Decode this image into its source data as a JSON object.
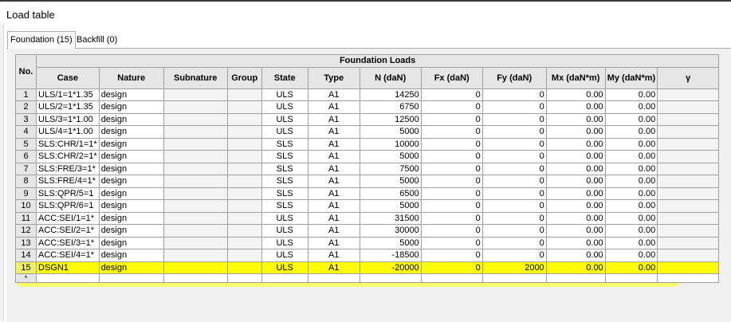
{
  "window": {
    "title": "Load table"
  },
  "tabs": [
    {
      "label": "Foundation (15)",
      "active": true
    },
    {
      "label": "Backfill (0)",
      "active": false
    }
  ],
  "table": {
    "group_header": "Foundation Loads",
    "no_header": "No.",
    "columns": [
      "Case",
      "Nature",
      "Subnature",
      "Group",
      "State",
      "Type",
      "N (daN)",
      "Fx (daN)",
      "Fy (daN)",
      "Mx (daN*m)",
      "My (daN*m)",
      "γ"
    ],
    "rows": [
      {
        "no": "1",
        "case": "ULS/1=1*1.35",
        "nature": "design",
        "subnature": "",
        "group": "",
        "state": "ULS",
        "type": "A1",
        "n": "14250",
        "fx": "0",
        "fy": "0",
        "mx": "0.00",
        "my": "0.00",
        "gamma": ""
      },
      {
        "no": "2",
        "case": "ULS/2=1*1.35",
        "nature": "design",
        "subnature": "",
        "group": "",
        "state": "ULS",
        "type": "A1",
        "n": "6750",
        "fx": "0",
        "fy": "0",
        "mx": "0.00",
        "my": "0.00",
        "gamma": ""
      },
      {
        "no": "3",
        "case": "ULS/3=1*1.00",
        "nature": "design",
        "subnature": "",
        "group": "",
        "state": "ULS",
        "type": "A1",
        "n": "12500",
        "fx": "0",
        "fy": "0",
        "mx": "0.00",
        "my": "0.00",
        "gamma": ""
      },
      {
        "no": "4",
        "case": "ULS/4=1*1.00",
        "nature": "design",
        "subnature": "",
        "group": "",
        "state": "ULS",
        "type": "A1",
        "n": "5000",
        "fx": "0",
        "fy": "0",
        "mx": "0.00",
        "my": "0.00",
        "gamma": ""
      },
      {
        "no": "5",
        "case": "SLS:CHR/1=1*",
        "nature": "design",
        "subnature": "",
        "group": "",
        "state": "SLS",
        "type": "A1",
        "n": "10000",
        "fx": "0",
        "fy": "0",
        "mx": "0.00",
        "my": "0.00",
        "gamma": ""
      },
      {
        "no": "6",
        "case": "SLS:CHR/2=1*",
        "nature": "design",
        "subnature": "",
        "group": "",
        "state": "SLS",
        "type": "A1",
        "n": "5000",
        "fx": "0",
        "fy": "0",
        "mx": "0.00",
        "my": "0.00",
        "gamma": ""
      },
      {
        "no": "7",
        "case": "SLS:FRE/3=1*",
        "nature": "design",
        "subnature": "",
        "group": "",
        "state": "SLS",
        "type": "A1",
        "n": "7500",
        "fx": "0",
        "fy": "0",
        "mx": "0.00",
        "my": "0.00",
        "gamma": ""
      },
      {
        "no": "8",
        "case": "SLS:FRE/4=1*",
        "nature": "design",
        "subnature": "",
        "group": "",
        "state": "SLS",
        "type": "A1",
        "n": "5000",
        "fx": "0",
        "fy": "0",
        "mx": "0.00",
        "my": "0.00",
        "gamma": ""
      },
      {
        "no": "9",
        "case": "SLS:QPR/5=1",
        "nature": "design",
        "subnature": "",
        "group": "",
        "state": "SLS",
        "type": "A1",
        "n": "6500",
        "fx": "0",
        "fy": "0",
        "mx": "0.00",
        "my": "0.00",
        "gamma": ""
      },
      {
        "no": "10",
        "case": "SLS:QPR/6=1",
        "nature": "design",
        "subnature": "",
        "group": "",
        "state": "SLS",
        "type": "A1",
        "n": "5000",
        "fx": "0",
        "fy": "0",
        "mx": "0.00",
        "my": "0.00",
        "gamma": ""
      },
      {
        "no": "11",
        "case": "ACC:SEI/1=1*",
        "nature": "design",
        "subnature": "",
        "group": "",
        "state": "ULS",
        "type": "A1",
        "n": "31500",
        "fx": "0",
        "fy": "0",
        "mx": "0.00",
        "my": "0.00",
        "gamma": ""
      },
      {
        "no": "12",
        "case": "ACC:SEI/2=1*",
        "nature": "design",
        "subnature": "",
        "group": "",
        "state": "ULS",
        "type": "A1",
        "n": "30000",
        "fx": "0",
        "fy": "0",
        "mx": "0.00",
        "my": "0.00",
        "gamma": ""
      },
      {
        "no": "13",
        "case": "ACC:SEI/3=1*",
        "nature": "design",
        "subnature": "",
        "group": "",
        "state": "ULS",
        "type": "A1",
        "n": "5000",
        "fx": "0",
        "fy": "0",
        "mx": "0.00",
        "my": "0.00",
        "gamma": ""
      },
      {
        "no": "14",
        "case": "ACC:SEI/4=1*",
        "nature": "design",
        "subnature": "",
        "group": "",
        "state": "ULS",
        "type": "A1",
        "n": "-18500",
        "fx": "0",
        "fy": "0",
        "mx": "0.00",
        "my": "0.00",
        "gamma": ""
      },
      {
        "no": "15",
        "case": "DSGN1",
        "nature": "design",
        "subnature": "",
        "group": "",
        "state": "ULS",
        "type": "A1",
        "n": "-20000",
        "fx": "0",
        "fy": "2000",
        "mx": "0.00",
        "my": "0.00",
        "gamma": ""
      }
    ],
    "new_row_marker": "*",
    "highlighted_row": "15"
  },
  "colors": {
    "highlight": "#ffff00",
    "header_bg": "#e6e6e6",
    "grid_line": "#a0a0a0"
  }
}
